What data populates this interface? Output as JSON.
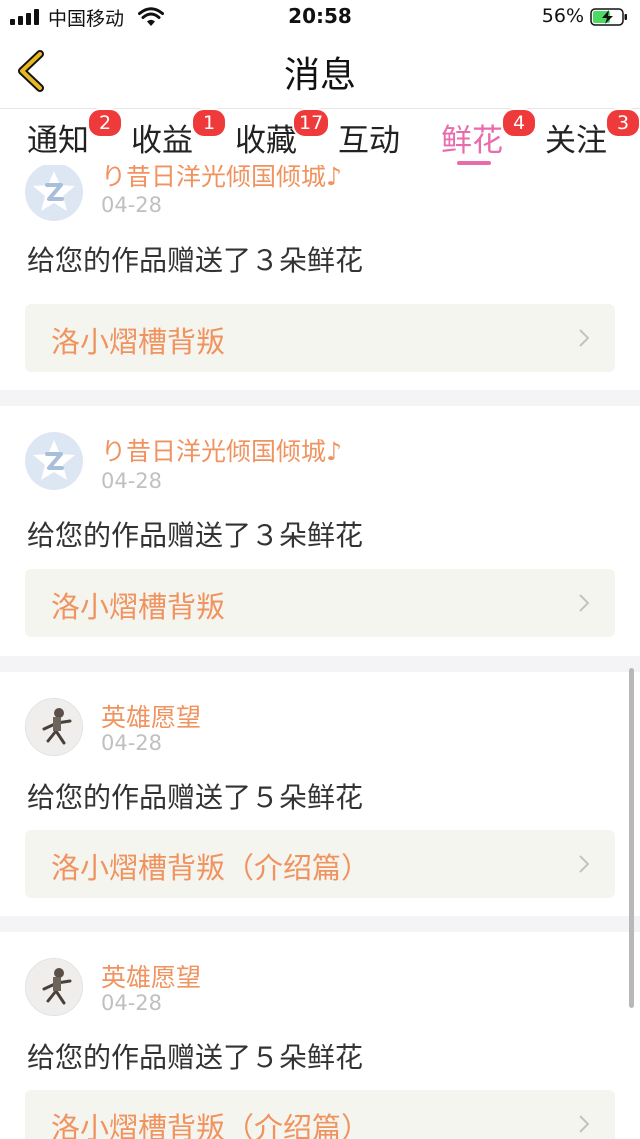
{
  "status_bar": {
    "carrier": "中国移动",
    "time": "20:58",
    "battery": "56%"
  },
  "header": {
    "title": "消息",
    "back_icon": "chevron-left-icon"
  },
  "tabs": [
    {
      "label": "通知",
      "badge": "2",
      "active": false
    },
    {
      "label": "收益",
      "badge": "1",
      "active": false
    },
    {
      "label": "收藏",
      "badge": "17",
      "active": false
    },
    {
      "label": "互动",
      "badge": "",
      "active": false
    },
    {
      "label": "鲜花",
      "badge": "4",
      "active": true
    },
    {
      "label": "关注",
      "badge": "3",
      "active": false
    }
  ],
  "messages": [
    {
      "user": "り昔日洋光倾国倾城♪",
      "date": "04-28",
      "text": "给您的作品赠送了３朵鲜花",
      "work": "洛小熠槽背叛",
      "avatar": "qq-default-avatar"
    },
    {
      "user": "り昔日洋光倾国倾城♪",
      "date": "04-28",
      "text": "给您的作品赠送了３朵鲜花",
      "work": "洛小熠槽背叛",
      "avatar": "qq-default-avatar"
    },
    {
      "user": "英雄愿望",
      "date": "04-28",
      "text": "给您的作品赠送了５朵鲜花",
      "work": "洛小熠槽背叛（介绍篇）",
      "avatar": "user-photo-avatar"
    },
    {
      "user": "英雄愿望",
      "date": "04-28",
      "text": "给您的作品赠送了５朵鲜花",
      "work": "洛小熠槽背叛（介绍篇）",
      "avatar": "user-photo-avatar"
    }
  ],
  "colors": {
    "accent_pink": "#e86bab",
    "username_orange": "#f0935f",
    "badge_red": "#ee3a3a",
    "back_yellow": "#e8b820"
  }
}
